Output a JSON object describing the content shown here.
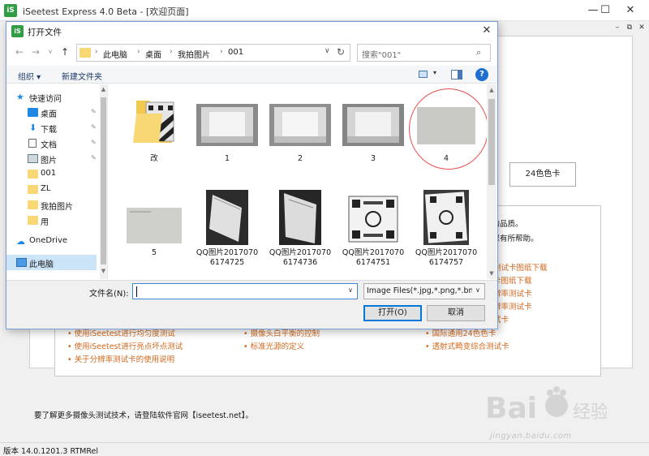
{
  "app": {
    "title": "iSeetest Express 4.0 Beta - [欢迎页面]",
    "logo": "iS",
    "min_glyph": "—",
    "max_glyph": "☐",
    "close_glyph": "✕",
    "mdi_min": "–",
    "mdi_restore": "⧉",
    "mdi_close": "✕"
  },
  "main": {
    "chart_button": "24色色卡",
    "intro_line1": "头的品质。",
    "intro_line2": "对您有所帮助。",
    "help_col3": [
      "测试卡图纸下载",
      "卡图纸下载",
      "辨率测试卡",
      "辨率测试卡",
      "试卡",
      "国际通用24色色卡",
      "透射式畸变综合测试卡"
    ],
    "help_col1": [
      "使用iSeetest进行均匀度测试",
      "使用iSeetest进行亮点坏点测试",
      "关于分辨率测试卡的使用说明"
    ],
    "help_col2": [
      "摄像头白平衡的控制",
      "标准光源的定义"
    ],
    "bottom_note": "要了解更多摄像头测试技术，请登陆软件官网【iseetest.net】。",
    "version": "版本 14.0.1201.3 RTMRel",
    "watermark": "jingyan.baidu.com"
  },
  "dialog": {
    "icon": "iS",
    "title": "打开文件",
    "close": "✕",
    "nav_back": "←",
    "nav_forward": "→",
    "nav_recent": "∨",
    "nav_up": "↑",
    "breadcrumb": [
      "此电脑",
      "桌面",
      "我拍图片",
      "001"
    ],
    "crumb_sep": "›",
    "addr_dropdown": "∨",
    "refresh": "↻",
    "search_placeholder": "搜索\"001\"",
    "search_icon": "⌕",
    "toolbar": {
      "organize": "组织 ▾",
      "new_folder": "新建文件夹",
      "view_dd": "▾",
      "help": "?"
    },
    "nav_pane": [
      {
        "label": "快速访问",
        "icon": "star-icon",
        "pinned": false
      },
      {
        "label": "桌面",
        "icon": "desktop-icon",
        "pinned": true
      },
      {
        "label": "下载",
        "icon": "download-icon",
        "pinned": true
      },
      {
        "label": "文档",
        "icon": "document-icon",
        "pinned": true
      },
      {
        "label": "图片",
        "icon": "pictures-icon",
        "pinned": true
      },
      {
        "label": "001",
        "icon": "folder-icon",
        "pinned": false
      },
      {
        "label": "ZL",
        "icon": "folder-icon",
        "pinned": false
      },
      {
        "label": "我拍图片",
        "icon": "folder-icon",
        "pinned": false
      },
      {
        "label": "用",
        "icon": "folder-icon",
        "pinned": false
      },
      {
        "label": "OneDrive",
        "icon": "cloud-icon",
        "pinned": false
      },
      {
        "label": "此电脑",
        "icon": "pc-icon",
        "pinned": false
      }
    ],
    "pin_glyph": "📌",
    "files_row1": [
      "改",
      "1",
      "2",
      "3",
      "4"
    ],
    "files_row2": [
      "5",
      "QQ图片20170706174725",
      "QQ图片20170706174736",
      "QQ图片20170706174751",
      "QQ图片20170706174757"
    ],
    "filename_label": "文件名(N):",
    "filename_value": "",
    "filetype": "Image Files(*.jpg,*.png,*.bmp",
    "open_button": "打开(O)",
    "cancel_button": "取消",
    "dd_glyph": "∨"
  }
}
